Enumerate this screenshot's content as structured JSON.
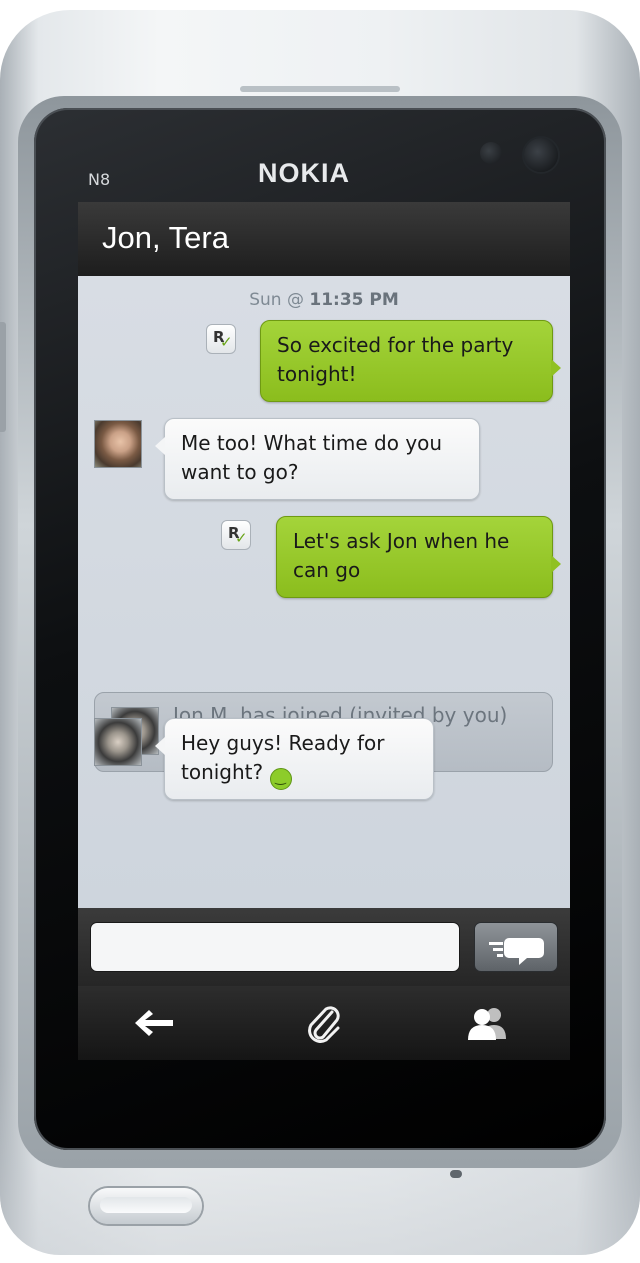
{
  "device": {
    "model_label": "N8",
    "brand_label": "NOKIA"
  },
  "conversation": {
    "title": "Jon, Tera",
    "timestamp_day": "Sun @",
    "timestamp_time": "11:35 PM"
  },
  "messages": [
    {
      "direction": "outgoing",
      "text": "So excited for the party tonight!",
      "receipt": "R"
    },
    {
      "direction": "incoming",
      "sender_avatar": "tera",
      "text": "Me too! What time do you want to go?"
    },
    {
      "direction": "outgoing",
      "text": "Let's ask Jon when he can go",
      "receipt": "R"
    },
    {
      "direction": "system",
      "sender_avatar": "jon",
      "text": "Jon M. has joined (invited by you)"
    },
    {
      "direction": "incoming",
      "sender_avatar": "jon",
      "text": "Hey guys! Ready for tonight?",
      "emoji": "smiley-icon"
    }
  ],
  "composer": {
    "value": "",
    "placeholder": ""
  },
  "toolbar": {
    "icons": [
      "back-arrow-icon",
      "paperclip-icon",
      "participants-icon"
    ]
  },
  "colors": {
    "outgoing_bubble": "#9ccd2f",
    "incoming_bubble": "#f4f5f6",
    "chat_background": "#d2d8df"
  }
}
